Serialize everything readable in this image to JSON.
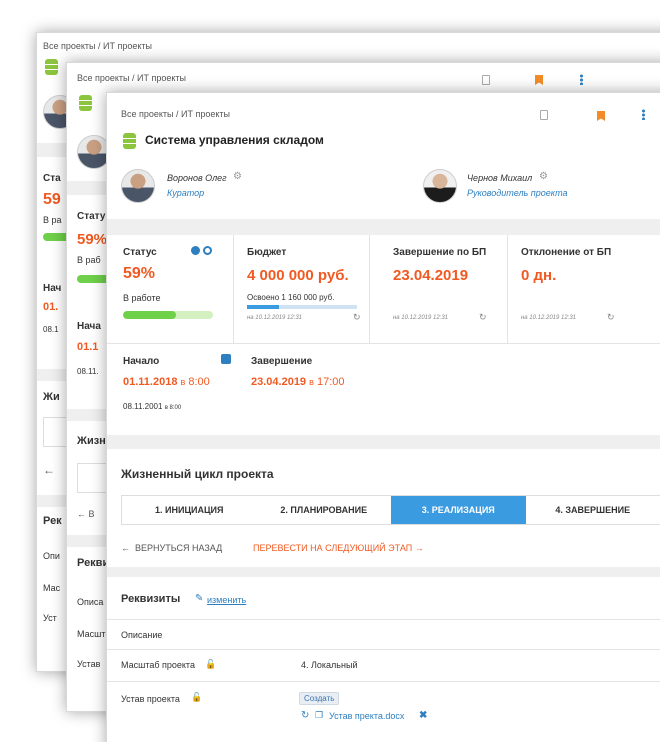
{
  "colors": {
    "accent_orange": "#f05a22",
    "accent_blue": "#2d7fc0",
    "progress_green": "#6fd04a",
    "step_active": "#3b9be0"
  },
  "breadcrumb": "Все проекты / ИТ проекты",
  "project": {
    "title": "Система управления складом"
  },
  "people": [
    {
      "name": "Воронов Олег",
      "role": "Куратор"
    },
    {
      "name": "Чернов Михаил",
      "role": "Руководитель проекта"
    }
  ],
  "status": {
    "label": "Статус",
    "percent": "59%",
    "state": "В работе",
    "progress": 0.59
  },
  "budget": {
    "label": "Бюджет",
    "value": "4 000 000 руб.",
    "spent": "Освоено  1 160 000 руб.",
    "spent_ratio": 0.29,
    "stamp": "на 10.12.2019 12:31"
  },
  "finish_bp": {
    "label": "Завершение по БП",
    "value": "23.04.2019",
    "stamp": "на 10.12.2019 12:31"
  },
  "deviation": {
    "label": "Отклонение от БП",
    "value": "0 дн.",
    "stamp": "на 10.12.2019 12:31"
  },
  "start": {
    "label": "Начало",
    "date": "01.11.2018",
    "time_prefix": "в",
    "time": "8:00",
    "plan_date": "08.11.2001",
    "plan_time": "в 8:00"
  },
  "end": {
    "label": "Завершение",
    "date": "23.04.2019",
    "time_prefix": "в",
    "time": "17:00"
  },
  "lifecycle": {
    "title": "Жизненный цикл проекта",
    "steps": [
      "1. ИНИЦИАЦИЯ",
      "2. ПЛАНИРОВАНИЕ",
      "3. РЕАЛИЗАЦИЯ",
      "4. ЗАВЕРШЕНИЕ"
    ],
    "back": "ВЕРНУТЬСЯ НАЗАД",
    "next": "ПЕРЕВЕСТИ НА СЛЕДУЮЩИЙ ЭТАП"
  },
  "requisites": {
    "title": "Реквизиты",
    "edit": "изменить",
    "description_label": "Описание",
    "scale_label": "Масштаб проекта",
    "scale_value": "4. Локальный",
    "charter_label": "Устав проекта",
    "create_button": "Создать",
    "file_name": "Устав пректа.docx"
  },
  "back_panels": {
    "status_short": "Ста",
    "status_short2": "Стату",
    "percent_short": "59",
    "percent_short2": "59%",
    "work_short": "В ра",
    "work_short2": "В раб",
    "start_short": "Нач",
    "start_short2": "Нача",
    "date_short": "01.",
    "date_short2": "01.1",
    "plan_short": "08.1",
    "plan_short2": "08.11.",
    "life_short": "Жи",
    "life_short2": "Жизн",
    "req_short": "Рек",
    "req_short2": "Рекви",
    "desc_short": "Опи",
    "desc_short2": "Описа",
    "scale_short": "Мас",
    "scale_short2": "Масшт",
    "charter_short": "Уст",
    "charter_short2": "Устав",
    "back_short": "В"
  }
}
